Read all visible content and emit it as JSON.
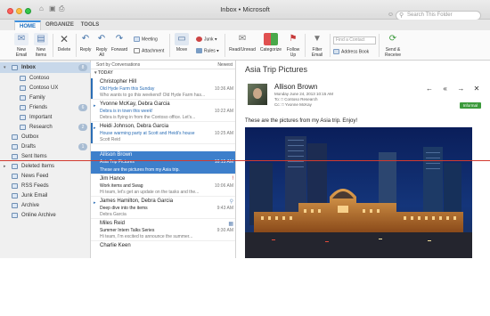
{
  "window": {
    "title": "Inbox • Microsoft",
    "search_placeholder": "Search This Folder"
  },
  "tabs": [
    {
      "label": "HOME"
    },
    {
      "label": "ORGANIZE"
    },
    {
      "label": "TOOLS"
    }
  ],
  "ribbon": {
    "new_email": "New\nEmail",
    "new_items": "New\nItems",
    "delete": "Delete",
    "reply": "Reply",
    "reply_all": "Reply\nAll",
    "forward": "Forward",
    "meeting": "Meeting",
    "attachment": "Attachment",
    "move": "Move",
    "junk": "Junk",
    "rules": "Rules",
    "read_unread": "Read/Unread",
    "categorize": "Categorize",
    "follow_up": "Follow\nUp",
    "filter_email": "Filter\nEmail",
    "find_contact_placeholder": "Find a Contact",
    "address_book": "Address Book",
    "send_receive": "Send &\nReceive"
  },
  "sidebar": {
    "items": [
      {
        "label": "Inbox",
        "count": "8"
      },
      {
        "label": "Contoso",
        "count": ""
      },
      {
        "label": "Contoso UX",
        "count": ""
      },
      {
        "label": "Family",
        "count": ""
      },
      {
        "label": "Friends",
        "count": "6"
      },
      {
        "label": "Important",
        "count": ""
      },
      {
        "label": "Research",
        "count": "2"
      },
      {
        "label": "Outbox",
        "count": ""
      },
      {
        "label": "Drafts",
        "count": "1"
      },
      {
        "label": "Sent Items",
        "count": ""
      },
      {
        "label": "Deleted Items",
        "count": ""
      },
      {
        "label": "News Feed",
        "count": ""
      },
      {
        "label": "RSS Feeds",
        "count": ""
      },
      {
        "label": "Junk Email",
        "count": ""
      },
      {
        "label": "Archive",
        "count": ""
      },
      {
        "label": "Online Archive",
        "count": ""
      }
    ]
  },
  "message_list": {
    "sort_label": "Sort by Conversations",
    "order_label": "Newest",
    "group_label": "TODAY",
    "messages": [
      {
        "sender": "Christopher Hill",
        "subject": "Old Hyde Farm this Sunday",
        "preview": "Who wants to go this weekend! Old Hyde Farm has...",
        "date": "10:36 AM"
      },
      {
        "sender": "Yvonne McKay, Debra Garcia",
        "subject": "Debra is in town this week!",
        "preview": "Debra is flying in from the Contoso office. Let's...",
        "date": "10:22 AM"
      },
      {
        "sender": "Heidi Johnson, Debra Garcia",
        "subject": "House warming party at Scott and Heidi's house",
        "preview": "Scott Reid",
        "date": "10:25 AM"
      },
      {
        "sender": "Allison Brown",
        "subject": "Asia Trip Pictures",
        "preview": "These are the pictures from my Asia trip.",
        "date": "10:15 AM"
      },
      {
        "sender": "Jim Hance",
        "subject": "Work items and Swag",
        "preview": "Hi team, let's get an update on the tasks and the...",
        "date": "10:06 AM"
      },
      {
        "sender": "James Hamilton, Debra Garcia",
        "subject": "Deep dive into the items",
        "preview": "Debra Garcia",
        "date": "9:43 AM"
      },
      {
        "sender": "Miles Reid",
        "subject": "Summer Intern Talks Series",
        "preview": "Hi team, I'm excited to announce the summer...",
        "date": "9:30 AM"
      },
      {
        "sender": "Charlie Keen",
        "subject": "",
        "preview": "",
        "date": ""
      }
    ]
  },
  "reading_pane": {
    "subject": "Asia Trip Pictures",
    "from": "Allison Brown",
    "sent": "Monday June 24, 2013 10:15 AM",
    "to": "To:  □ Contoso Research",
    "cc": "Cc:  □ Yvonne McKay",
    "badge": "Informal",
    "body": "These are the pictures from my Asia trip.   Enjoy!"
  },
  "colors": {
    "accent": "#2a6db5",
    "selection": "#3d7fcb",
    "overlay_line": "#d23a2f"
  }
}
